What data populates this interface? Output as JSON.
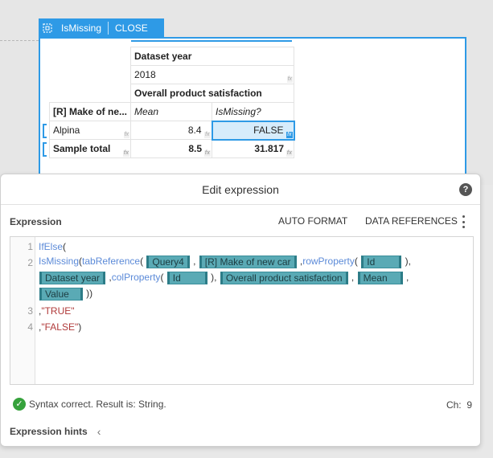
{
  "report": {
    "toolbar": {
      "name": "IsMissing",
      "close_label": "CLOSE",
      "select_icon": "selection-frame-icon"
    },
    "table": {
      "dataset_year_header": "Dataset year",
      "year": "2018",
      "measure_header": "Overall product satisfaction",
      "row_header": "[R] Make of ne...",
      "col_mean": "Mean",
      "col_ismissing": "IsMissing?",
      "rows": [
        {
          "label": "Alpina",
          "mean": "8.4",
          "ismissing": "FALSE"
        },
        {
          "label": "Sample total",
          "mean": "8.5",
          "ismissing": "31.817"
        }
      ],
      "fx_label": "fx"
    }
  },
  "panel": {
    "title": "Edit expression",
    "help_icon": "?",
    "expression_label": "Expression",
    "auto_format": "AUTO FORMAT",
    "data_references": "DATA REFERENCES",
    "lines": {
      "n1": "1",
      "n2": "2",
      "n3": "3",
      "n4": "4",
      "l1_fn": "IfElse",
      "l1_p": "(",
      "l2_fn1": "IsMissing",
      "l2_fn2": "tabReference",
      "l2_tok1": "Query4",
      "l2_tok2": "[R] Make of new car",
      "l2_fn3": "rowProperty",
      "l2_tok3": "Id",
      "l2b_tok1": "Dataset year",
      "l2b_fn": "colProperty",
      "l2b_tok2": "Id",
      "l2b_tok3": "Overall product satisfaction",
      "l2b_tok4": "Mean",
      "l2c_tok": "Value",
      "l3": "\"TRUE\"",
      "l4": "\"FALSE\""
    },
    "status_text": "Syntax correct. Result is: String.",
    "ch_label": "Ch:",
    "ch_value": "9",
    "hints_label": "Expression hints",
    "colors": {
      "accent": "#2e9ae6",
      "token": "#5aaab5",
      "ok": "#36a23c"
    }
  }
}
